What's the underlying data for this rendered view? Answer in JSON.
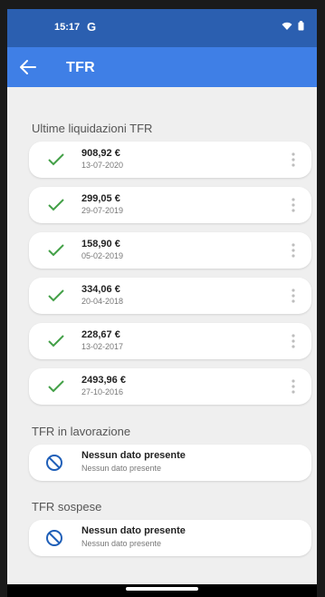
{
  "status_bar": {
    "time": "15:17",
    "g_label": "G"
  },
  "app_bar": {
    "title": "TFR"
  },
  "sections": {
    "ultime_title": "Ultime liquidazioni TFR",
    "lavorazione_title": "TFR in lavorazione",
    "sospese_title": "TFR sospese"
  },
  "liquidazioni": [
    {
      "amount": "908,92 €",
      "date": "13-07-2020"
    },
    {
      "amount": "299,05 €",
      "date": "29-07-2019"
    },
    {
      "amount": "158,90 €",
      "date": "05-02-2019"
    },
    {
      "amount": "334,06 €",
      "date": "20-04-2018"
    },
    {
      "amount": "228,67 €",
      "date": "13-02-2017"
    },
    {
      "amount": "2493,96 €",
      "date": "27-10-2016"
    }
  ],
  "lavorazione": {
    "title": "Nessun dato presente",
    "subtitle": "Nessun dato presente"
  },
  "sospese": {
    "title": "Nessun dato presente",
    "subtitle": "Nessun dato presente"
  },
  "colors": {
    "status_bar": "#2b5fb0",
    "app_bar": "#3f7fe6",
    "check": "#43a047",
    "ban": "#1f5fb8"
  },
  "icons": {
    "back": "arrow-left-icon",
    "check": "check-icon",
    "more": "more-vertical-icon",
    "empty": "ban-icon",
    "wifi": "wifi-icon",
    "battery": "battery-icon"
  }
}
